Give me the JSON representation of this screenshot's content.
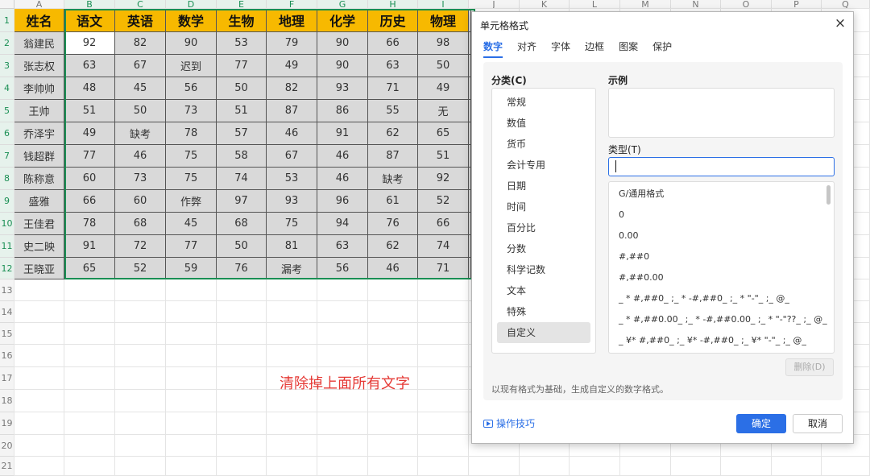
{
  "sheet": {
    "columns": [
      "A",
      "B",
      "C",
      "D",
      "E",
      "F",
      "G",
      "H",
      "I",
      "J",
      "K",
      "L",
      "M",
      "N",
      "O",
      "P",
      "Q"
    ],
    "rows": [
      "1",
      "2",
      "3",
      "4",
      "5",
      "6",
      "7",
      "8",
      "9",
      "10",
      "11",
      "12",
      "13",
      "14",
      "15",
      "16",
      "17",
      "18",
      "19",
      "20",
      "21"
    ],
    "headers": [
      "姓名",
      "语文",
      "英语",
      "数学",
      "生物",
      "地理",
      "化学",
      "历史",
      "物理"
    ],
    "data": [
      [
        "翁建民",
        "92",
        "82",
        "90",
        "53",
        "79",
        "90",
        "66",
        "98"
      ],
      [
        "张志权",
        "63",
        "67",
        "迟到",
        "77",
        "49",
        "90",
        "63",
        "50"
      ],
      [
        "李帅帅",
        "48",
        "45",
        "56",
        "50",
        "82",
        "93",
        "71",
        "49"
      ],
      [
        "王帅",
        "51",
        "50",
        "73",
        "51",
        "87",
        "86",
        "55",
        "无"
      ],
      [
        "乔泽宇",
        "49",
        "缺考",
        "78",
        "57",
        "46",
        "91",
        "62",
        "65"
      ],
      [
        "钱超群",
        "77",
        "46",
        "75",
        "58",
        "67",
        "46",
        "87",
        "51"
      ],
      [
        "陈称意",
        "60",
        "73",
        "75",
        "74",
        "53",
        "46",
        "缺考",
        "92"
      ],
      [
        "盛雅",
        "66",
        "60",
        "作弊",
        "97",
        "93",
        "96",
        "61",
        "52"
      ],
      [
        "王佳君",
        "78",
        "68",
        "45",
        "68",
        "75",
        "94",
        "76",
        "66"
      ],
      [
        "史二映",
        "91",
        "72",
        "77",
        "50",
        "81",
        "63",
        "62",
        "74"
      ],
      [
        "王晓亚",
        "65",
        "52",
        "59",
        "76",
        "漏考",
        "56",
        "46",
        "71"
      ]
    ]
  },
  "annotation": "清除掉上面所有文字",
  "dialog": {
    "title": "单元格格式",
    "close": "×",
    "tabs": [
      "数字",
      "对齐",
      "字体",
      "边框",
      "图案",
      "保护"
    ],
    "category_label": "分类(C)",
    "categories": [
      "常规",
      "数值",
      "货币",
      "会计专用",
      "日期",
      "时间",
      "百分比",
      "分数",
      "科学记数",
      "文本",
      "特殊",
      "自定义"
    ],
    "sample_label": "示例",
    "type_label": "类型(T)",
    "type_value": "",
    "formats": [
      "G/通用格式",
      "0",
      "0.00",
      "#,##0",
      "#,##0.00",
      "_ * #,##0_ ;_ * -#,##0_ ;_ * \"-\"_ ;_ @_",
      "_ * #,##0.00_ ;_ * -#,##0.00_ ;_ * \"-\"??_ ;_ @_",
      "_ ¥* #,##0_ ;_ ¥* -#,##0_ ;_ ¥* \"-\"_ ;_ @_"
    ],
    "delete_label": "删除(D)",
    "hint": "以现有格式为基础，生成自定义的数字格式。",
    "tips_label": "操作技巧",
    "ok_label": "确定",
    "cancel_label": "取消"
  },
  "colors": {
    "header_fill": "#f7b900",
    "selection": "#1a8f54",
    "accent": "#2b6fe6",
    "annotation": "#e53935"
  }
}
